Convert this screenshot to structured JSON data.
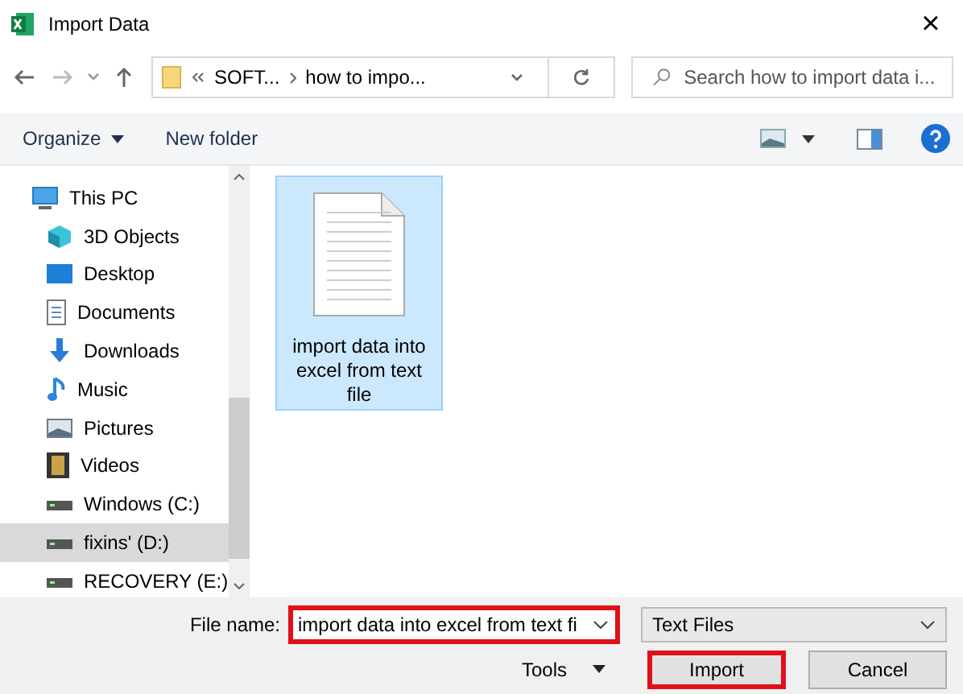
{
  "window": {
    "title": "Import Data",
    "close": "×"
  },
  "address": {
    "crumbs": [
      {
        "label": "SOFT..."
      },
      {
        "label": "how to impo..."
      }
    ]
  },
  "search": {
    "placeholder": "Search how to import data i..."
  },
  "toolbar": {
    "organize": "Organize",
    "new_folder": "New folder"
  },
  "sidebar": {
    "items": [
      {
        "label": "This PC",
        "kind": "computer",
        "selected": false,
        "children": [
          {
            "label": "3D Objects",
            "kind": "cube",
            "selected": false
          },
          {
            "label": "Desktop",
            "kind": "desktop",
            "selected": false
          },
          {
            "label": "Documents",
            "kind": "document",
            "selected": false
          },
          {
            "label": "Downloads",
            "kind": "download",
            "selected": false
          },
          {
            "label": "Music",
            "kind": "music",
            "selected": false
          },
          {
            "label": "Pictures",
            "kind": "picture",
            "selected": false
          },
          {
            "label": "Videos",
            "kind": "video",
            "selected": false
          },
          {
            "label": "Windows (C:)",
            "kind": "drive",
            "selected": false
          },
          {
            "label": "fixins' (D:)",
            "kind": "drive",
            "selected": true
          },
          {
            "label": "RECOVERY (E:)",
            "kind": "drive",
            "selected": false
          }
        ]
      }
    ]
  },
  "files": [
    {
      "name": "import data into excel from text file",
      "selected": true
    }
  ],
  "footer": {
    "file_name_label": "File name:",
    "file_name_value": "import data into excel from text fi",
    "file_name_highlighted": true,
    "file_type": "Text Files",
    "tools": "Tools",
    "import": "Import",
    "import_highlighted": true,
    "cancel": "Cancel"
  }
}
